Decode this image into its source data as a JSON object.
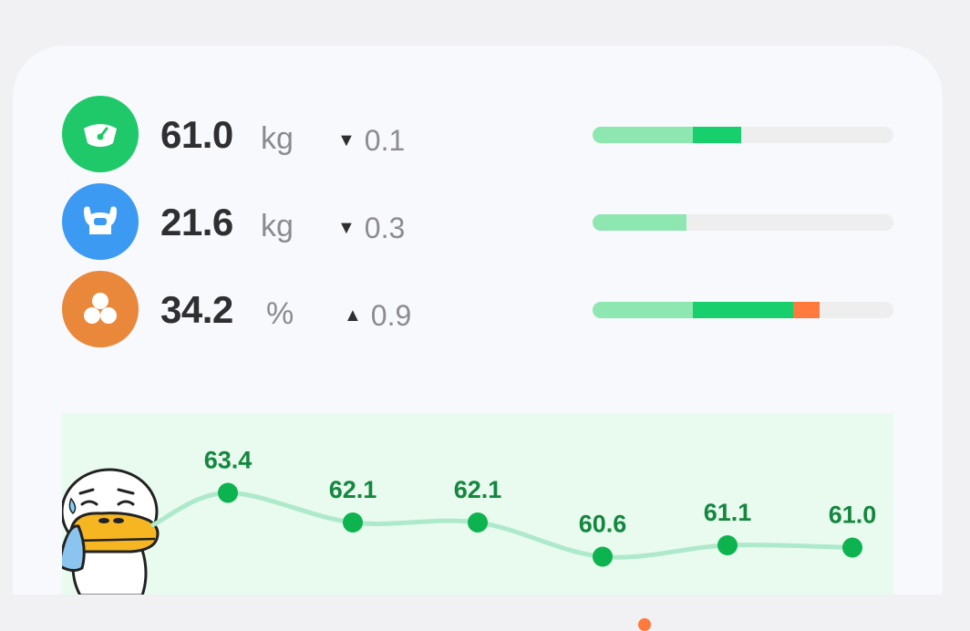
{
  "metrics": [
    {
      "name": "weight",
      "value": "61.0",
      "unit": "kg",
      "direction": "down",
      "delta_symbol": "▼",
      "delta": "0.1",
      "icon": "scale-icon",
      "icon_color": "#1fc96a",
      "level_fraction": 0.5
    },
    {
      "name": "muscle",
      "value": "21.6",
      "unit": "kg",
      "direction": "down",
      "delta_symbol": "▼",
      "delta": "0.3",
      "icon": "muscle-icon",
      "icon_color": "#3d9af2",
      "level_fraction": 0.31
    },
    {
      "name": "body-fat",
      "value": "34.2",
      "unit": "%",
      "direction": "up",
      "delta_symbol": "▲",
      "delta": "0.9",
      "icon": "fat-icon",
      "icon_color": "#e9873a",
      "level_fraction": 0.76
    }
  ],
  "colors": {
    "bar_track": "#eeeeef",
    "bar_low": "#8ee7b0",
    "bar_normal": "#17cf6c",
    "bar_high": "#ff7a3c",
    "chart_bg": "#e8fbee",
    "chart_line": "#aee9cb",
    "chart_point": "#0db34f",
    "chart_label": "#14873f"
  },
  "chart_data": {
    "type": "line",
    "series": [
      {
        "values": [
          63.4,
          62.1,
          62.1,
          60.6,
          61.1,
          61.0
        ]
      }
    ],
    "labels": [
      "63.4",
      "62.1",
      "62.1",
      "60.6",
      "61.1",
      "61.0"
    ],
    "ylim": [
      59.5,
      64.5
    ],
    "grid": false,
    "legend": "none"
  },
  "mascot": {
    "name": "mascot-duck-sweating"
  }
}
